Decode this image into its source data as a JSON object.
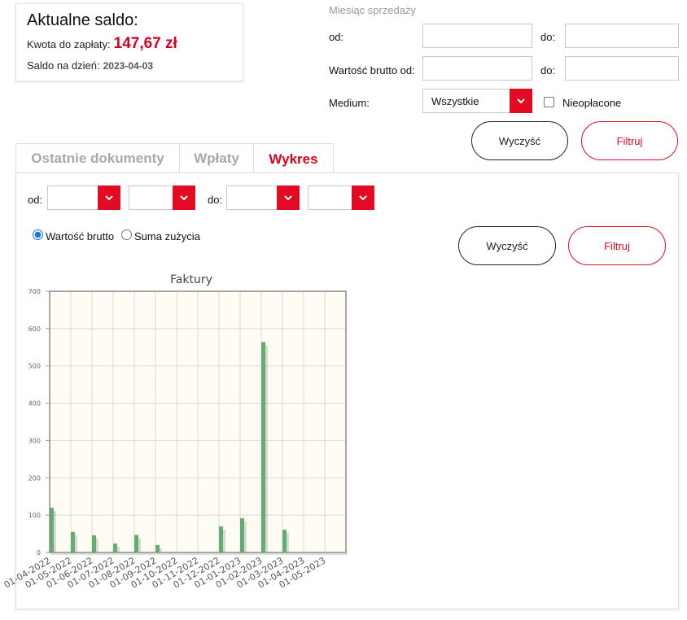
{
  "balance": {
    "title": "Aktualne saldo:",
    "amount_label": "Kwota do zapłaty:",
    "amount": "147,67 zł",
    "date_label": "Saldo na dzień:",
    "date": "2023-04-03"
  },
  "filters": {
    "section_title": "Miesiąc sprzedaży",
    "from_label": "od:",
    "to_label": "do:",
    "gross_from_label": "Wartość brutto od:",
    "gross_to_label": "do:",
    "medium_label": "Medium:",
    "medium_value": "Wszystkie",
    "unpaid_label": "Nieopłacone",
    "clear_label": "Wyczyść",
    "filter_label": "Filtruj"
  },
  "tabs": [
    {
      "label": "Ostatnie dokumenty",
      "active": false
    },
    {
      "label": "Wpłaty",
      "active": false
    },
    {
      "label": "Wykres",
      "active": true
    }
  ],
  "chart_filters": {
    "from_label": "od:",
    "to_label": "do:",
    "radio_gross": "Wartość brutto",
    "radio_usage": "Suma zużycia",
    "clear_label": "Wyczyść",
    "filter_label": "Filtruj"
  },
  "colors": {
    "accent": "#e30a24",
    "bar": "#5fae72",
    "plot_bg": "#fffdf3"
  },
  "chart_data": {
    "type": "bar",
    "title": "Faktury",
    "categories": [
      "01-04-2022",
      "01-05-2022",
      "01-06-2022",
      "01-07-2022",
      "01-08-2022",
      "01-09-2022",
      "01-10-2022",
      "01-11-2022",
      "01-12-2022",
      "01-01-2023",
      "01-02-2023",
      "01-03-2023",
      "01-04-2023",
      "01-05-2023"
    ],
    "values": [
      120,
      55,
      46,
      24,
      47,
      20,
      0,
      0,
      70,
      92,
      564,
      61,
      0,
      0
    ],
    "yticks": [
      0,
      100,
      200,
      300,
      400,
      500,
      600,
      700
    ],
    "ylim": [
      0,
      700
    ],
    "xlabel": "",
    "ylabel": "",
    "grid": true
  }
}
